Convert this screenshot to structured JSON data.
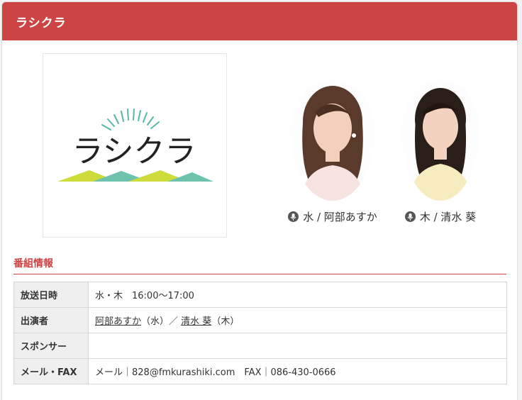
{
  "header": {
    "title": "ラシクラ"
  },
  "logo": {
    "text": "ラシクラ"
  },
  "hosts": [
    {
      "caption": "水 / 阿部あすか"
    },
    {
      "caption": "木 / 清水 葵"
    }
  ],
  "info": {
    "title": "番組情報",
    "rows": [
      {
        "label": "放送日時",
        "value": "水・木　16:00〜17:00"
      },
      {
        "label": "出演者",
        "host1_link": "阿部あすか",
        "host1_day": "（水）／",
        "host2_link": "清水 葵",
        "host2_day": "（木）"
      },
      {
        "label": "スポンサー",
        "value": ""
      },
      {
        "label": "メール・FAX",
        "value": "メール｜828@fmkurashiki.com　FAX｜086-430-0666"
      }
    ]
  },
  "colors": {
    "accent": "#cc4444"
  },
  "icons": {
    "caption": "mic-icon"
  }
}
